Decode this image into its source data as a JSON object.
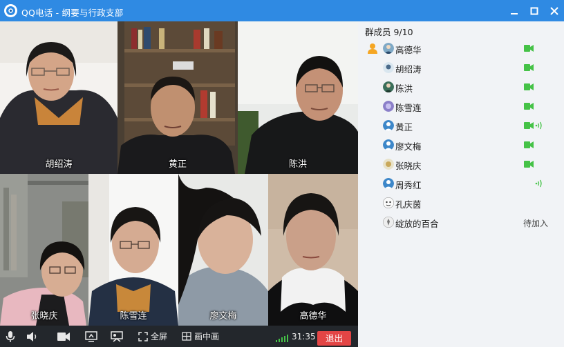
{
  "window": {
    "title": "QQ电话 - 纲要与行政支部"
  },
  "videos": [
    {
      "name": "胡绍涛"
    },
    {
      "name": "黄正"
    },
    {
      "name": "陈洪"
    },
    {
      "name": "张晓庆"
    },
    {
      "name": "陈雪连"
    },
    {
      "name": "廖文梅"
    },
    {
      "name": "高德华"
    }
  ],
  "toolbar": {
    "fullscreen_label": "全屏",
    "pip_label": "画中画",
    "timer": "31:35",
    "exit_label": "退出"
  },
  "sidebar": {
    "header": "群成员 9/10",
    "members": [
      {
        "name": "高德华",
        "host": true,
        "camera": true,
        "speaking": false,
        "status": ""
      },
      {
        "name": "胡绍涛",
        "host": false,
        "camera": true,
        "speaking": false,
        "status": ""
      },
      {
        "name": "陈洪",
        "host": false,
        "camera": true,
        "speaking": false,
        "status": ""
      },
      {
        "name": "陈雪连",
        "host": false,
        "camera": true,
        "speaking": false,
        "status": ""
      },
      {
        "name": "黄正",
        "host": false,
        "camera": true,
        "speaking": true,
        "status": ""
      },
      {
        "name": "廖文梅",
        "host": false,
        "camera": true,
        "speaking": false,
        "status": ""
      },
      {
        "name": "张晓庆",
        "host": false,
        "camera": true,
        "speaking": false,
        "status": ""
      },
      {
        "name": "周秀红",
        "host": false,
        "camera": false,
        "speaking": true,
        "status": ""
      },
      {
        "name": "孔庆茵",
        "host": false,
        "camera": false,
        "speaking": false,
        "status": ""
      },
      {
        "name": "绽放的百合",
        "host": false,
        "camera": false,
        "speaking": false,
        "status": "待加入"
      }
    ]
  },
  "colors": {
    "titlebar": "#2f8ae3",
    "accent_green": "#45c247",
    "exit": "#e34545",
    "sidebar_bg": "#f1f3f6",
    "toolbar_bg": "#23272c"
  }
}
